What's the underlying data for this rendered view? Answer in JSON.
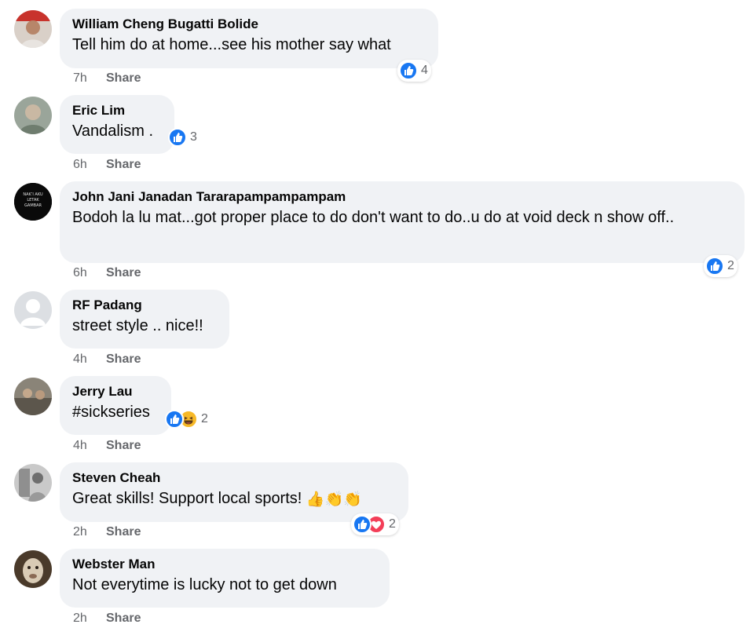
{
  "colors": {
    "bubble_bg": "#f0f2f5",
    "like_blue": "#1877f2",
    "love_red": "#f33e58",
    "haha_yellow": "#f7b928",
    "meta_gray": "#65676b"
  },
  "comments": [
    {
      "author": "William Cheng Bugatti Bolide",
      "text": "Tell him do at home...see his mother say what",
      "time": "7h",
      "share": "Share",
      "reactions": [
        "like-icon"
      ],
      "reaction_count": "4"
    },
    {
      "author": "Eric Lim",
      "text": "Vandalism .",
      "time": "6h",
      "share": "Share",
      "reactions": [
        "like-icon"
      ],
      "reaction_count": "3"
    },
    {
      "author": "John Jani Janadan Tararapampampampam",
      "text": "Bodoh la lu mat...got proper place to do don't want to do..u do at void deck n show off..",
      "time": "6h",
      "share": "Share",
      "reactions": [
        "like-icon"
      ],
      "reaction_count": "2",
      "avatar_text": "NAK’I AKU LETAK GAMBAR"
    },
    {
      "author": "RF Padang",
      "text": "street style .. nice!!",
      "time": "4h",
      "share": "Share"
    },
    {
      "author": "Jerry Lau",
      "text": "#sickseries",
      "time": "4h",
      "share": "Share",
      "reactions": [
        "like-icon",
        "haha-icon"
      ],
      "reaction_count": "2"
    },
    {
      "author": "Steven Cheah",
      "text": "Great skills! Support local sports!",
      "emojis": "👍👏👏",
      "time": "2h",
      "share": "Share",
      "reactions": [
        "like-icon",
        "love-icon"
      ],
      "reaction_count": "2"
    },
    {
      "author": "Webster Man",
      "text": "Not everytime is lucky not to get down",
      "time": "2h",
      "share": "Share"
    }
  ]
}
